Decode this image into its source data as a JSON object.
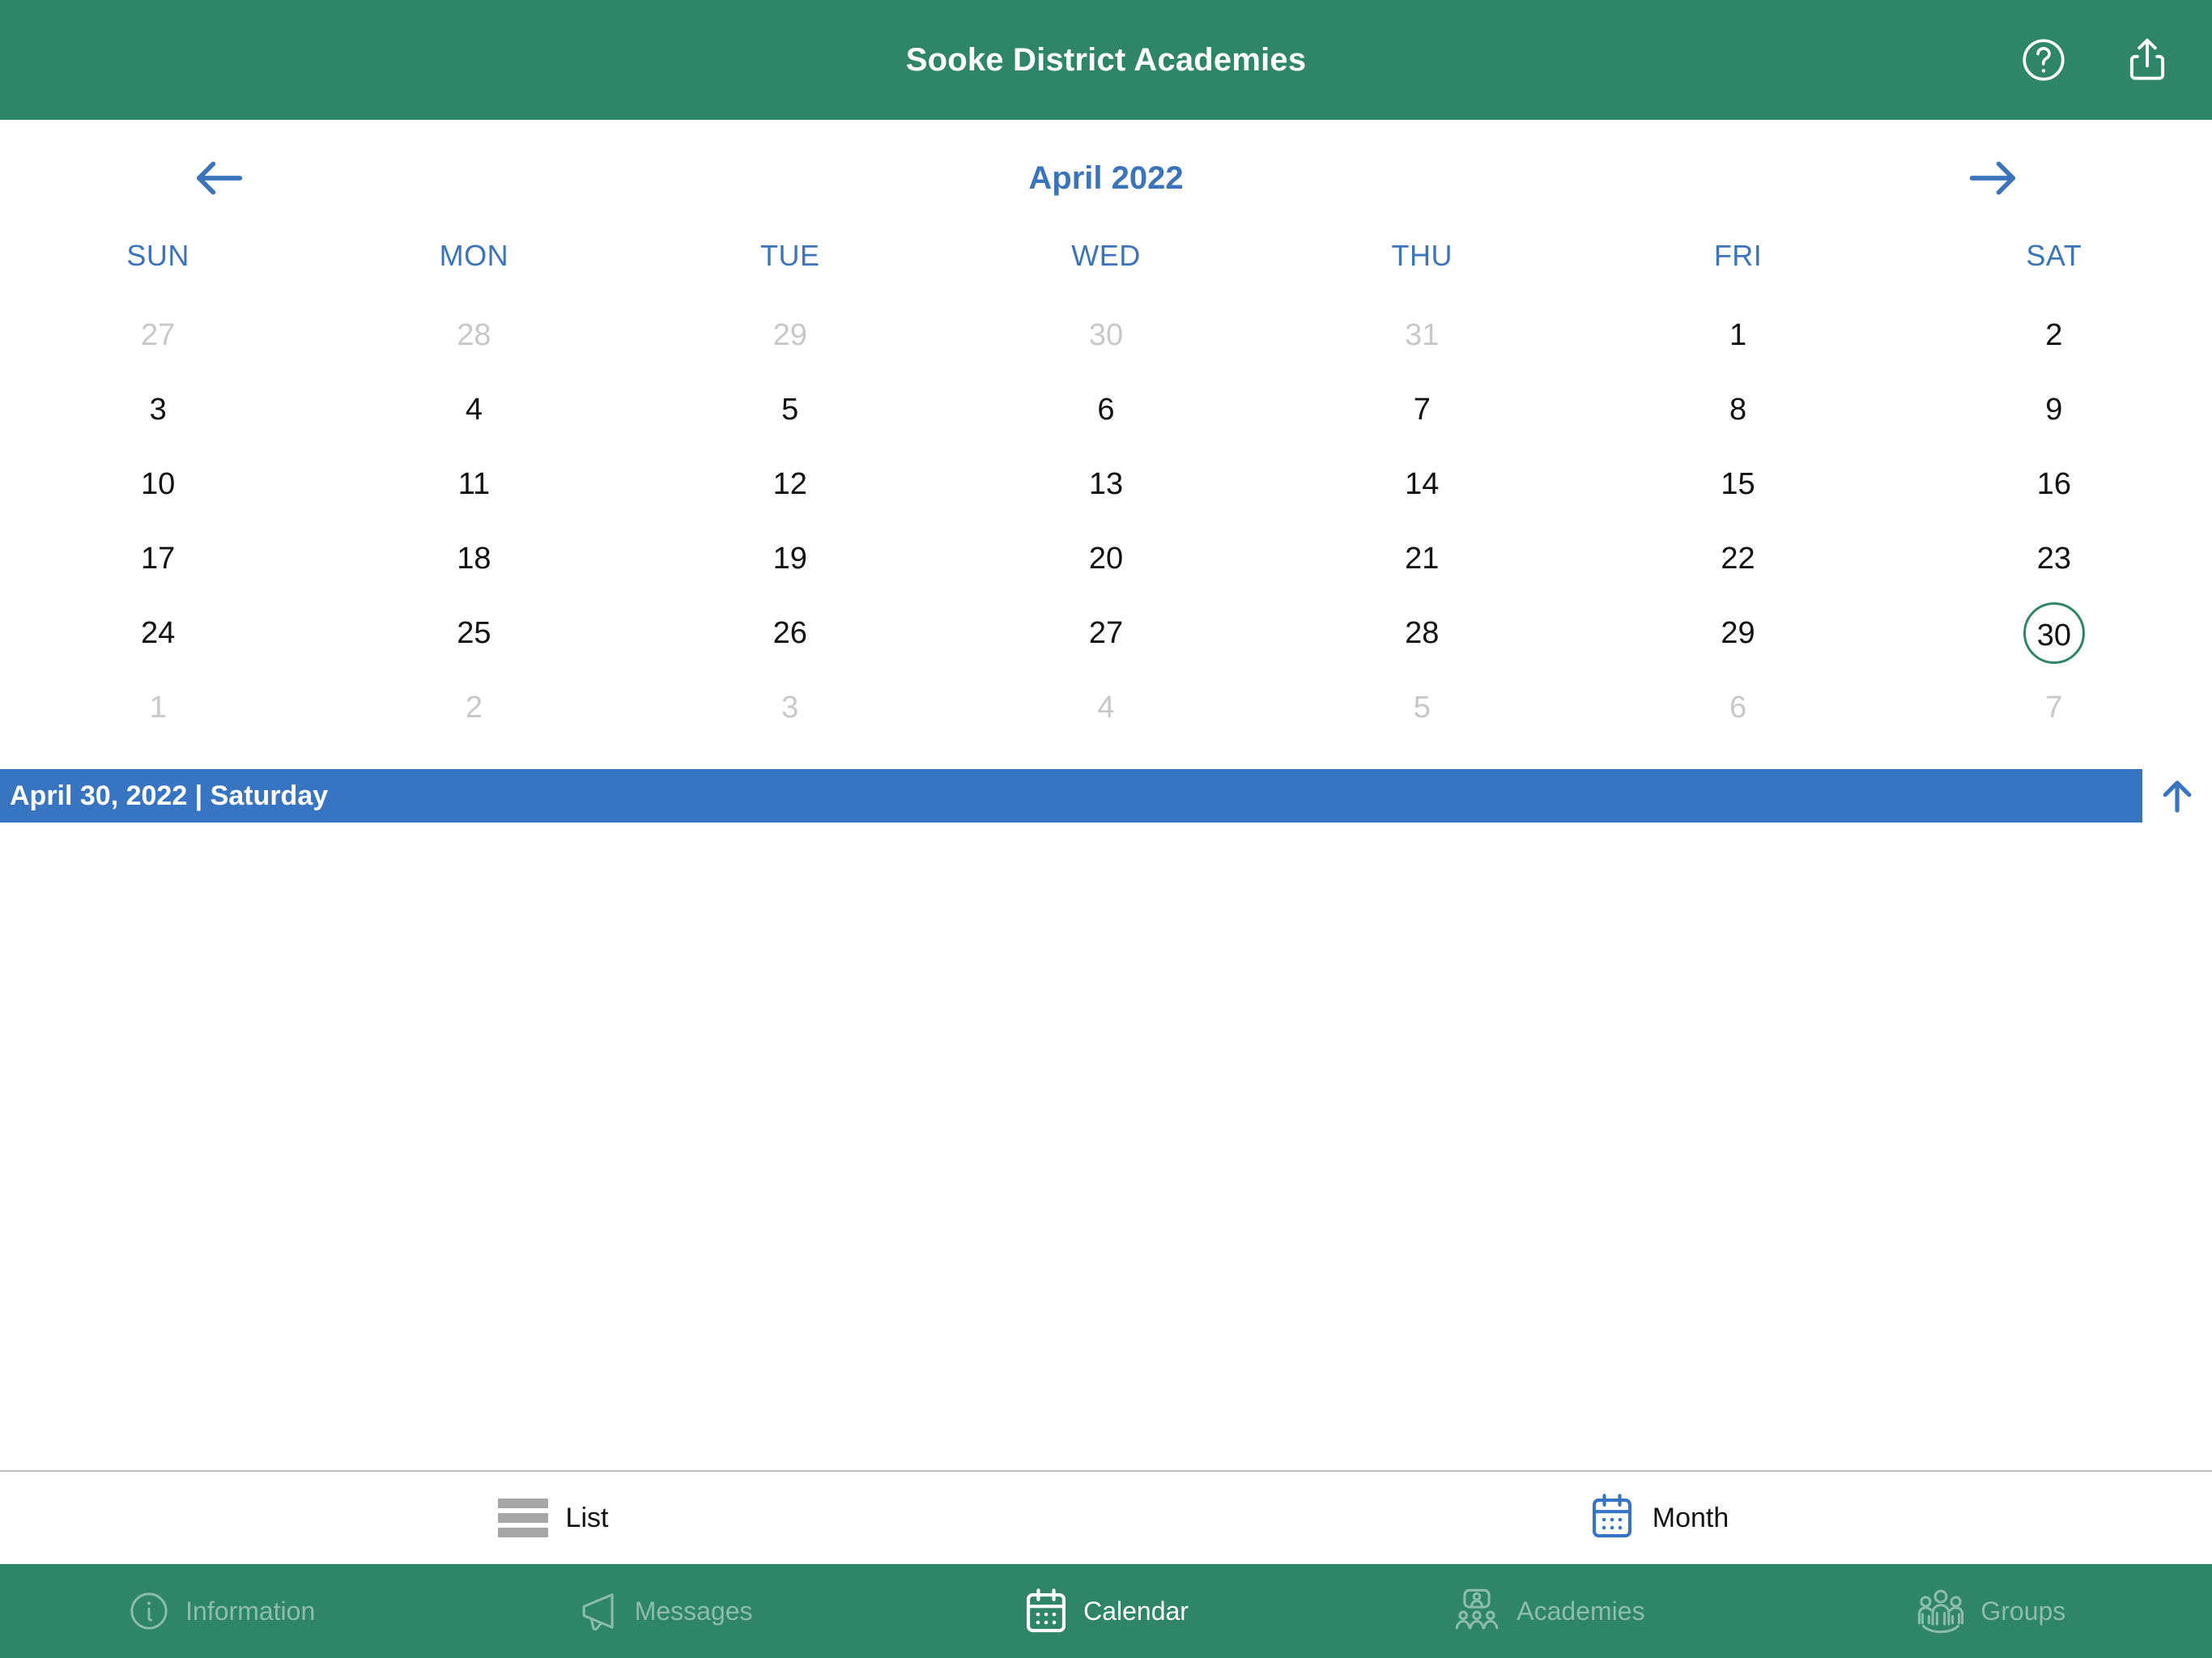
{
  "header": {
    "title": "Sooke District Academies",
    "help_icon": "help-circle-icon",
    "share_icon": "share-icon",
    "background_color": "#2E8568"
  },
  "calendar": {
    "month_title": "April 2022",
    "prev_icon": "arrow-left-icon",
    "next_icon": "arrow-right-icon",
    "accent_color": "#3C74BC",
    "selected_ring_color": "#2E8568",
    "weekdays": [
      "SUN",
      "MON",
      "TUE",
      "WED",
      "THU",
      "FRI",
      "SAT"
    ],
    "weeks": [
      [
        {
          "n": "27",
          "muted": true,
          "selected": false
        },
        {
          "n": "28",
          "muted": true,
          "selected": false
        },
        {
          "n": "29",
          "muted": true,
          "selected": false
        },
        {
          "n": "30",
          "muted": true,
          "selected": false
        },
        {
          "n": "31",
          "muted": true,
          "selected": false
        },
        {
          "n": "1",
          "muted": false,
          "selected": false
        },
        {
          "n": "2",
          "muted": false,
          "selected": false
        }
      ],
      [
        {
          "n": "3",
          "muted": false,
          "selected": false
        },
        {
          "n": "4",
          "muted": false,
          "selected": false
        },
        {
          "n": "5",
          "muted": false,
          "selected": false
        },
        {
          "n": "6",
          "muted": false,
          "selected": false
        },
        {
          "n": "7",
          "muted": false,
          "selected": false
        },
        {
          "n": "8",
          "muted": false,
          "selected": false
        },
        {
          "n": "9",
          "muted": false,
          "selected": false
        }
      ],
      [
        {
          "n": "10",
          "muted": false,
          "selected": false
        },
        {
          "n": "11",
          "muted": false,
          "selected": false
        },
        {
          "n": "12",
          "muted": false,
          "selected": false
        },
        {
          "n": "13",
          "muted": false,
          "selected": false
        },
        {
          "n": "14",
          "muted": false,
          "selected": false
        },
        {
          "n": "15",
          "muted": false,
          "selected": false
        },
        {
          "n": "16",
          "muted": false,
          "selected": false
        }
      ],
      [
        {
          "n": "17",
          "muted": false,
          "selected": false
        },
        {
          "n": "18",
          "muted": false,
          "selected": false
        },
        {
          "n": "19",
          "muted": false,
          "selected": false
        },
        {
          "n": "20",
          "muted": false,
          "selected": false
        },
        {
          "n": "21",
          "muted": false,
          "selected": false
        },
        {
          "n": "22",
          "muted": false,
          "selected": false
        },
        {
          "n": "23",
          "muted": false,
          "selected": false
        }
      ],
      [
        {
          "n": "24",
          "muted": false,
          "selected": false
        },
        {
          "n": "25",
          "muted": false,
          "selected": false
        },
        {
          "n": "26",
          "muted": false,
          "selected": false
        },
        {
          "n": "27",
          "muted": false,
          "selected": false
        },
        {
          "n": "28",
          "muted": false,
          "selected": false
        },
        {
          "n": "29",
          "muted": false,
          "selected": false
        },
        {
          "n": "30",
          "muted": false,
          "selected": true
        }
      ],
      [
        {
          "n": "1",
          "muted": true,
          "selected": false
        },
        {
          "n": "2",
          "muted": true,
          "selected": false
        },
        {
          "n": "3",
          "muted": true,
          "selected": false
        },
        {
          "n": "4",
          "muted": true,
          "selected": false
        },
        {
          "n": "5",
          "muted": true,
          "selected": false
        },
        {
          "n": "6",
          "muted": true,
          "selected": false
        },
        {
          "n": "7",
          "muted": true,
          "selected": false
        }
      ]
    ]
  },
  "day_bar": {
    "label": "April 30, 2022 | Saturday",
    "background_color": "#3775C2",
    "collapse_icon": "arrow-up-icon"
  },
  "events": {
    "items": []
  },
  "view_switch": {
    "items": [
      {
        "label": "List",
        "icon": "list-icon",
        "active": false
      },
      {
        "label": "Month",
        "icon": "calendar-icon",
        "active": true
      }
    ]
  },
  "tabbar": {
    "background_color": "#2E8568",
    "items": [
      {
        "label": "Information",
        "icon": "info-circle-icon",
        "active": false
      },
      {
        "label": "Messages",
        "icon": "megaphone-icon",
        "active": false
      },
      {
        "label": "Calendar",
        "icon": "calendar-icon",
        "active": true
      },
      {
        "label": "Academies",
        "icon": "academies-icon",
        "active": false
      },
      {
        "label": "Groups",
        "icon": "groups-icon",
        "active": false
      }
    ]
  }
}
